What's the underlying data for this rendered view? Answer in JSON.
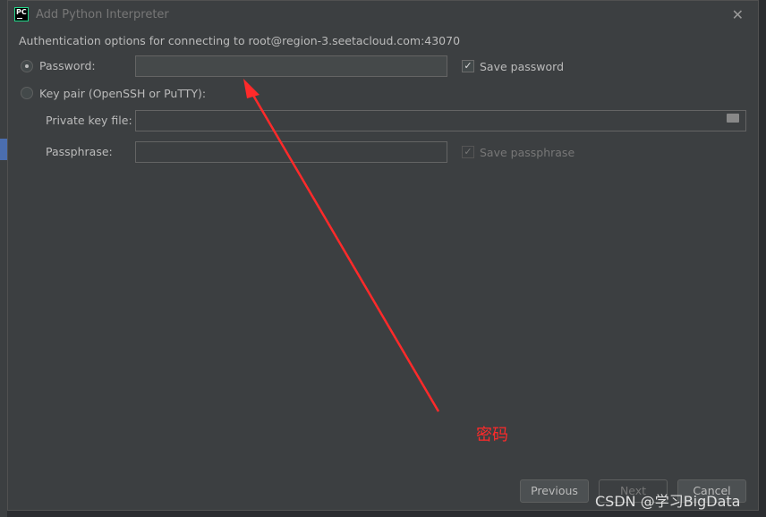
{
  "dialog": {
    "title": "Add Python Interpreter",
    "logo": "PC",
    "auth_text": "Authentication options for connecting to root@region-3.seetacloud.com:43070"
  },
  "password": {
    "label": "Password:",
    "selected": true,
    "value": "",
    "save_label": "Save password",
    "save_checked": true
  },
  "keypair": {
    "label": "Key pair (OpenSSH or PuTTY):",
    "selected": false,
    "private_key_label": "Private key file:",
    "passphrase_label": "Passphrase:",
    "save_label": "Save passphrase",
    "save_checked": true
  },
  "buttons": {
    "previous": "Previous",
    "next": "Next",
    "cancel": "Cancel"
  },
  "annotation": {
    "text": "密码",
    "color": "#ff2a2a"
  },
  "watermark": "CSDN @学习BigData"
}
